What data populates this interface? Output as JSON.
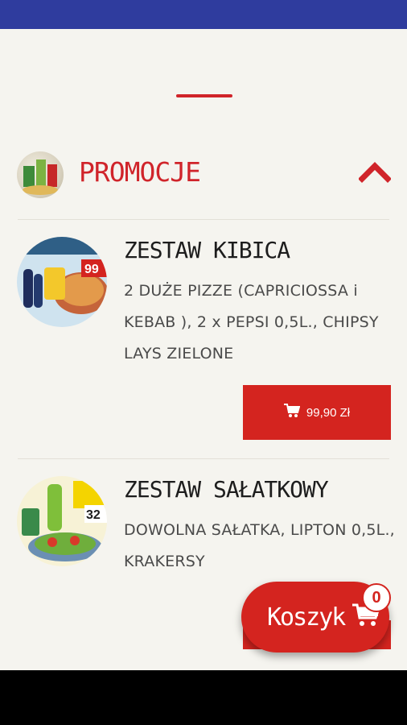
{
  "category": {
    "title": "PROMOCJE",
    "expanded": true
  },
  "products": [
    {
      "name": "ZESTAW KIBICA",
      "description": "2 DUŻE PIZZE (CAPRICIOSSA i KEBAB ), 2 x PEPSI 0,5L., CHIPSY LAYS ZIELONE",
      "price_label": "99,90 Zł",
      "image_badge": "99"
    },
    {
      "name": "ZESTAW SAŁATKOWY",
      "description": "DOWOLNA SAŁATKA, LIPTON 0,5L., KRAKERSY",
      "image_badge": "32"
    }
  ],
  "cart": {
    "label": "Koszyk",
    "count": "0"
  },
  "colors": {
    "status_bar": "#2f3c9e",
    "accent": "#d4241f",
    "background": "#f5f4ef"
  }
}
